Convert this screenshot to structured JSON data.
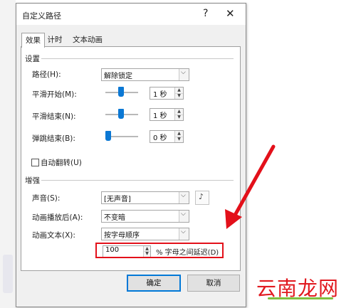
{
  "dialog": {
    "title": "自定义路径",
    "help_glyph": "?",
    "close_glyph": "✕"
  },
  "tabs": [
    {
      "label": "效果",
      "active": true
    },
    {
      "label": "计时",
      "active": false
    },
    {
      "label": "文本动画",
      "active": false
    }
  ],
  "settings": {
    "group_label": "设置",
    "path_label": "路径(H):",
    "path_value": "解除锁定",
    "smooth_start_label": "平滑开始(M):",
    "smooth_start_value": "1 秒",
    "smooth_start_level": 0.45,
    "smooth_end_label": "平滑结束(N):",
    "smooth_end_value": "1 秒",
    "smooth_end_level": 0.45,
    "bounce_end_label": "弹跳结束(B):",
    "bounce_end_value": "0 秒",
    "bounce_end_level": 0.0,
    "auto_reverse_label": "自动翻转(U)",
    "auto_reverse_checked": false
  },
  "enhancements": {
    "group_label": "增强",
    "sound_label": "声音(S):",
    "sound_value": "[无声音]",
    "after_anim_label": "动画播放后(A):",
    "after_anim_value": "不变暗",
    "anim_text_label": "动画文本(X):",
    "anim_text_value": "按字母顺序",
    "delay_value": "100",
    "delay_label": "% 字母之间延迟(D)"
  },
  "buttons": {
    "ok": "确定",
    "cancel": "取消"
  },
  "icons": {
    "dropdown": "chevron-down-icon",
    "spin_up": "spin-up-icon",
    "spin_down": "spin-down-icon",
    "sound": "speaker-icon"
  },
  "watermark": "云南龙网",
  "colors": {
    "accent": "#0b78d4",
    "highlight": "#e3101a",
    "watermark": "#e1191f"
  }
}
